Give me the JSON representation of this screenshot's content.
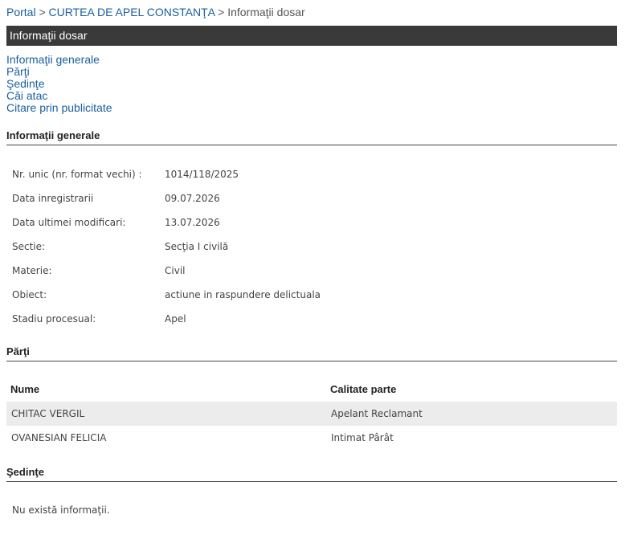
{
  "breadcrumb": {
    "portal": "Portal",
    "sep1": ">",
    "court": "CURTEA DE APEL CONSTANŢA",
    "sep2": ">",
    "current": "Informaţii dosar"
  },
  "title_bar": "Informaţii dosar",
  "anchors": [
    "Informaţii generale",
    "Părţi",
    "Şedinţe",
    "Căi atac",
    "Citare prin publicitate"
  ],
  "info_section": {
    "title": "Informaţii generale",
    "rows": [
      {
        "label": "Nr. unic (nr. format vechi) :",
        "value": "1014/118/2025"
      },
      {
        "label": "Data inregistrarii",
        "value": "09.07.2026"
      },
      {
        "label": "Data ultimei modificari:",
        "value": "13.07.2026"
      },
      {
        "label": "Sectie:",
        "value": "Secţia I civilă"
      },
      {
        "label": "Materie:",
        "value": "Civil"
      },
      {
        "label": "Obiect:",
        "value": "actiune in raspundere delictuala"
      },
      {
        "label": "Stadiu procesual:",
        "value": "Apel"
      }
    ]
  },
  "parti_section": {
    "title": "Părţi",
    "headers": [
      "Nume",
      "Calitate parte"
    ],
    "rows": [
      {
        "name": "CHITAC VERGIL",
        "role": "Apelant Reclamant"
      },
      {
        "name": "OVANESIAN FELICIA",
        "role": "Intimat Pârât"
      }
    ]
  },
  "sedinte_section": {
    "title": "Şedinţe",
    "empty_text": "Nu există informaţii."
  }
}
